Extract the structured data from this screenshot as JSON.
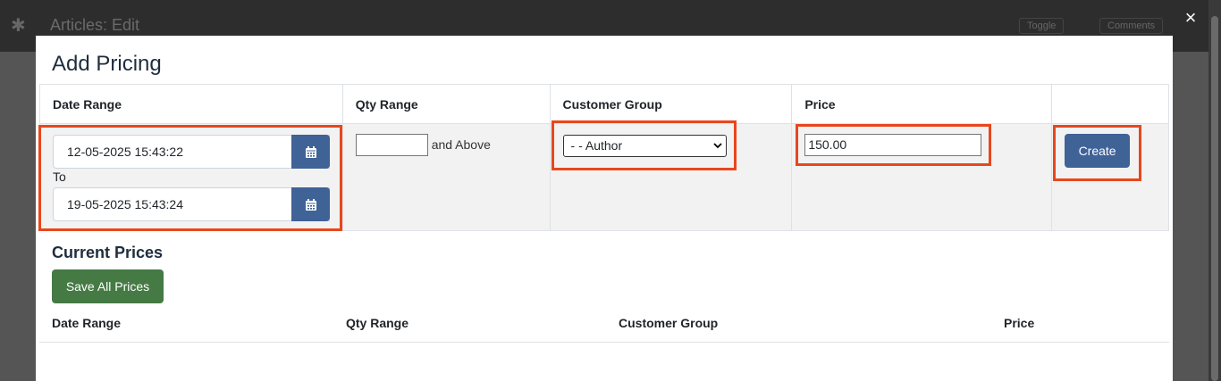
{
  "background": {
    "page_title": "Articles: Edit",
    "tools": [
      "Toggle",
      "Comments"
    ]
  },
  "modal": {
    "title": "Add Pricing",
    "close_symbol": "×",
    "table": {
      "headers": [
        "Date Range",
        "Qty Range",
        "Customer Group",
        "Price",
        ""
      ],
      "date_from": "12-05-2025 15:43:22",
      "to_label": "To",
      "date_to": "19-05-2025 15:43:24",
      "qty_value": "",
      "qty_suffix": "and Above",
      "customer_group_selected": "- - Author",
      "price_value": "150.00",
      "create_label": "Create"
    },
    "current": {
      "title": "Current Prices",
      "save_label": "Save All Prices",
      "headers": [
        "Date Range",
        "Qty Range",
        "Customer Group",
        "Price"
      ]
    }
  },
  "colors": {
    "primary": "#3f6297",
    "success": "#457a45",
    "highlight": "#e8471d"
  },
  "icons": [
    "calendar-icon",
    "close-icon",
    "chevron-down-icon"
  ]
}
